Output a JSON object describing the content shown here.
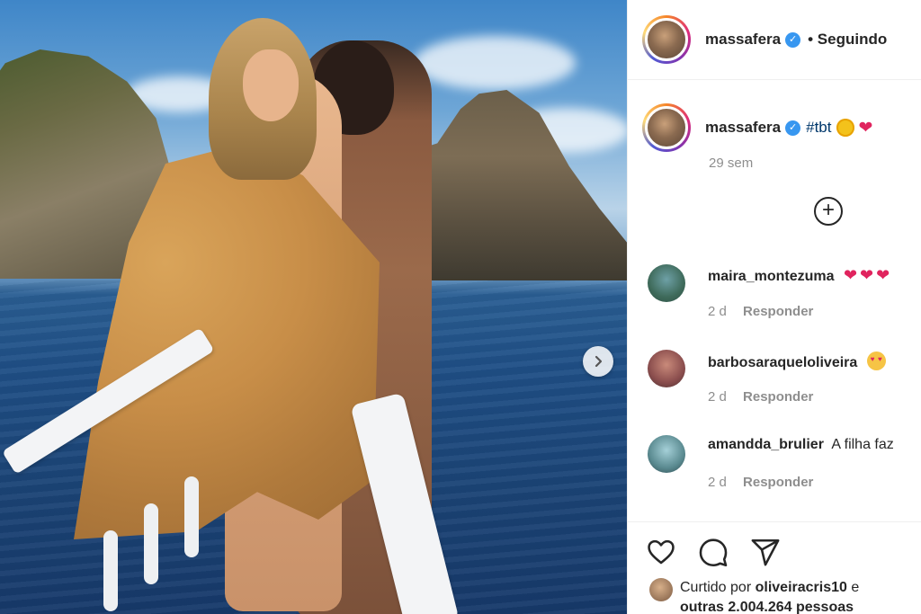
{
  "post": {
    "author": "massafera",
    "follow_status": "• Seguindo",
    "caption_tag": "#tbt",
    "age": "29 sem"
  },
  "comments": [
    {
      "user": "maira_montezuma",
      "text": "",
      "time": "2 d",
      "reply_label": "Responder"
    },
    {
      "user": "barbosaraqueloliveira",
      "text": "",
      "time": "2 d",
      "reply_label": "Responder"
    },
    {
      "user": "amandda_brulier",
      "text": "A filha faz",
      "time": "2 d",
      "reply_label": "Responder"
    }
  ],
  "likes": {
    "prefix": "Curtido por",
    "user": "oliveiracris10",
    "connector": "e",
    "others": "outras 2.004.264 pessoas"
  },
  "colors": {
    "verified": "#3897f0",
    "hashtag": "#00376b",
    "heart": "#e0245e",
    "muted": "#8e8e8e"
  },
  "icons": [
    "verified-badge-icon",
    "sun-emoji-icon",
    "red-heart-emoji-icon",
    "add-comment-plus-icon",
    "heart-eyes-emoji-icon",
    "like-heart-icon",
    "comment-bubble-icon",
    "share-paper-plane-icon",
    "next-chevron-icon"
  ]
}
